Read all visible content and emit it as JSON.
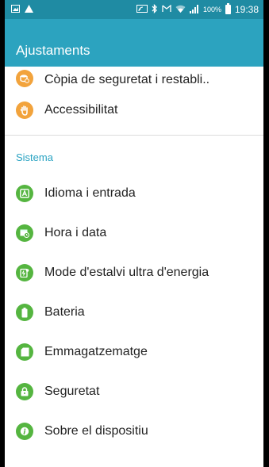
{
  "status_bar": {
    "battery_percent": "100%",
    "time": "19:38"
  },
  "app_bar": {
    "title": "Ajustaments"
  },
  "settings_top": [
    {
      "label": "Còpia de seguretat i restabli..",
      "icon": "backup-icon",
      "color": "#f2a33c"
    },
    {
      "label": "Accessibilitat",
      "icon": "hand-icon",
      "color": "#f2a33c"
    }
  ],
  "section": {
    "title": "Sistema"
  },
  "system_items": [
    {
      "label": "Idioma i entrada",
      "icon": "language-icon",
      "color": "#55b540"
    },
    {
      "label": "Hora i data",
      "icon": "calendar-clock-icon",
      "color": "#55b540"
    },
    {
      "label": "Mode d'estalvi ultra d'energia",
      "icon": "power-saving-icon",
      "color": "#55b540"
    },
    {
      "label": "Bateria",
      "icon": "battery-icon",
      "color": "#55b540"
    },
    {
      "label": "Emmagatzematge",
      "icon": "storage-icon",
      "color": "#55b540"
    },
    {
      "label": "Seguretat",
      "icon": "lock-icon",
      "color": "#55b540"
    },
    {
      "label": "Sobre el dispositiu",
      "icon": "info-icon",
      "color": "#55b540"
    }
  ]
}
